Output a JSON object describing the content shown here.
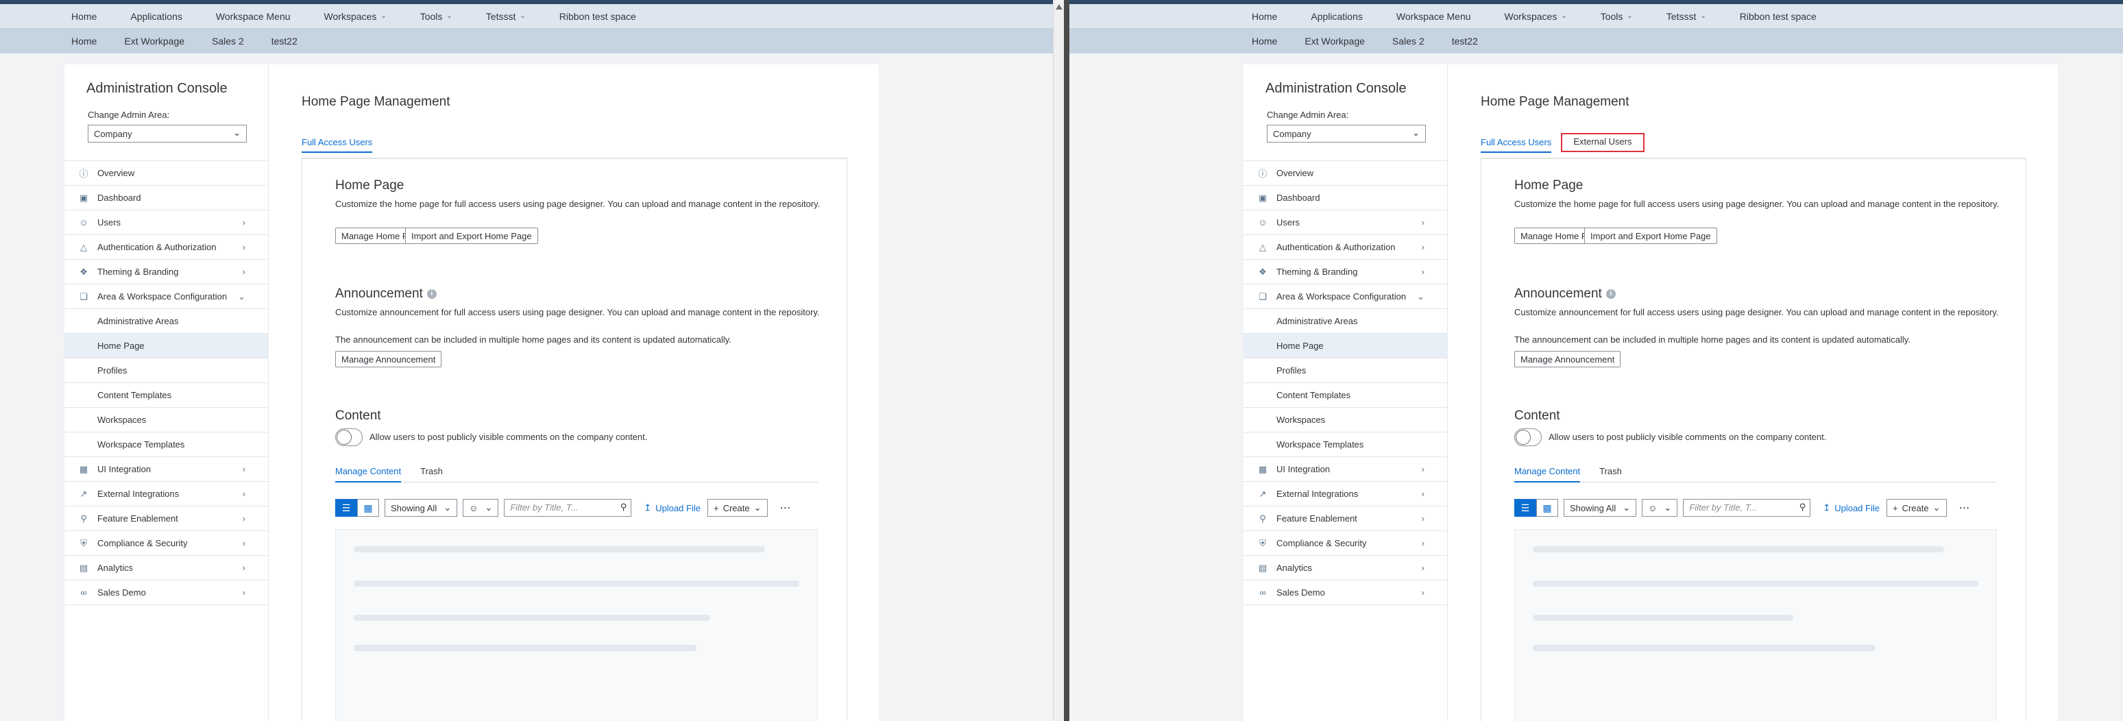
{
  "top_nav": [
    "Home",
    "Applications",
    "Workspace Menu",
    "Workspaces",
    "Tools",
    "Tetssst",
    "Ribbon test space"
  ],
  "top_nav_dropdowns": [
    "Workspaces",
    "Tools",
    "Tetssst"
  ],
  "second_nav": [
    "Home",
    "Ext Workpage",
    "Sales 2",
    "test22"
  ],
  "sidebar": {
    "title": "Administration Console",
    "area_label": "Change Admin Area:",
    "area_value": "Company",
    "items": [
      {
        "label": "Overview",
        "icon": "info-icon",
        "arrow": false
      },
      {
        "label": "Dashboard",
        "icon": "dashboard-icon",
        "arrow": false
      },
      {
        "label": "Users",
        "icon": "user-icon",
        "arrow": true
      },
      {
        "label": "Authentication & Authorization",
        "icon": "warning-icon",
        "arrow": true
      },
      {
        "label": "Theming & Branding",
        "icon": "palette-icon",
        "arrow": true
      },
      {
        "label": "Area & Workspace Configuration",
        "icon": "cube-icon",
        "arrow": "down"
      },
      {
        "label": "Administrative Areas",
        "sub": true
      },
      {
        "label": "Home Page",
        "sub": true,
        "selected": true
      },
      {
        "label": "Profiles",
        "sub": true
      },
      {
        "label": "Content Templates",
        "sub": true
      },
      {
        "label": "Workspaces",
        "sub": true
      },
      {
        "label": "Workspace Templates",
        "sub": true
      },
      {
        "label": "UI Integration",
        "icon": "ui-icon",
        "arrow": true
      },
      {
        "label": "External Integrations",
        "icon": "integration-icon",
        "arrow": true
      },
      {
        "label": "Feature Enablement",
        "icon": "key-icon",
        "arrow": true
      },
      {
        "label": "Compliance & Security",
        "icon": "shield-icon",
        "arrow": true
      },
      {
        "label": "Analytics",
        "icon": "chart-icon",
        "arrow": true
      },
      {
        "label": "Sales Demo",
        "icon": "glasses-icon",
        "arrow": true
      }
    ]
  },
  "main": {
    "title": "Home Page Management",
    "tab_full": "Full Access Users",
    "tab_external": "External Users",
    "home_page": {
      "heading": "Home Page",
      "desc": "Customize the home page for full access users using page designer. You can upload and manage content in the repository.",
      "btn_manage": "Manage Home Page",
      "btn_import": "Import and Export Home Page"
    },
    "announcement": {
      "heading": "Announcement",
      "desc1": "Customize announcement for full access users using page designer. You can upload and manage content in the repository.",
      "desc2": "The announcement can be included in multiple home pages and its content is updated automatically.",
      "btn_manage": "Manage Announcement"
    },
    "content": {
      "heading": "Content",
      "toggle_label": "Allow users to post publicly visible comments on the company content.",
      "tab_manage": "Manage Content",
      "tab_trash": "Trash",
      "showing": "Showing All",
      "filter_placeholder": "Filter by Title, T...",
      "upload": "Upload File",
      "create": "Create"
    }
  }
}
